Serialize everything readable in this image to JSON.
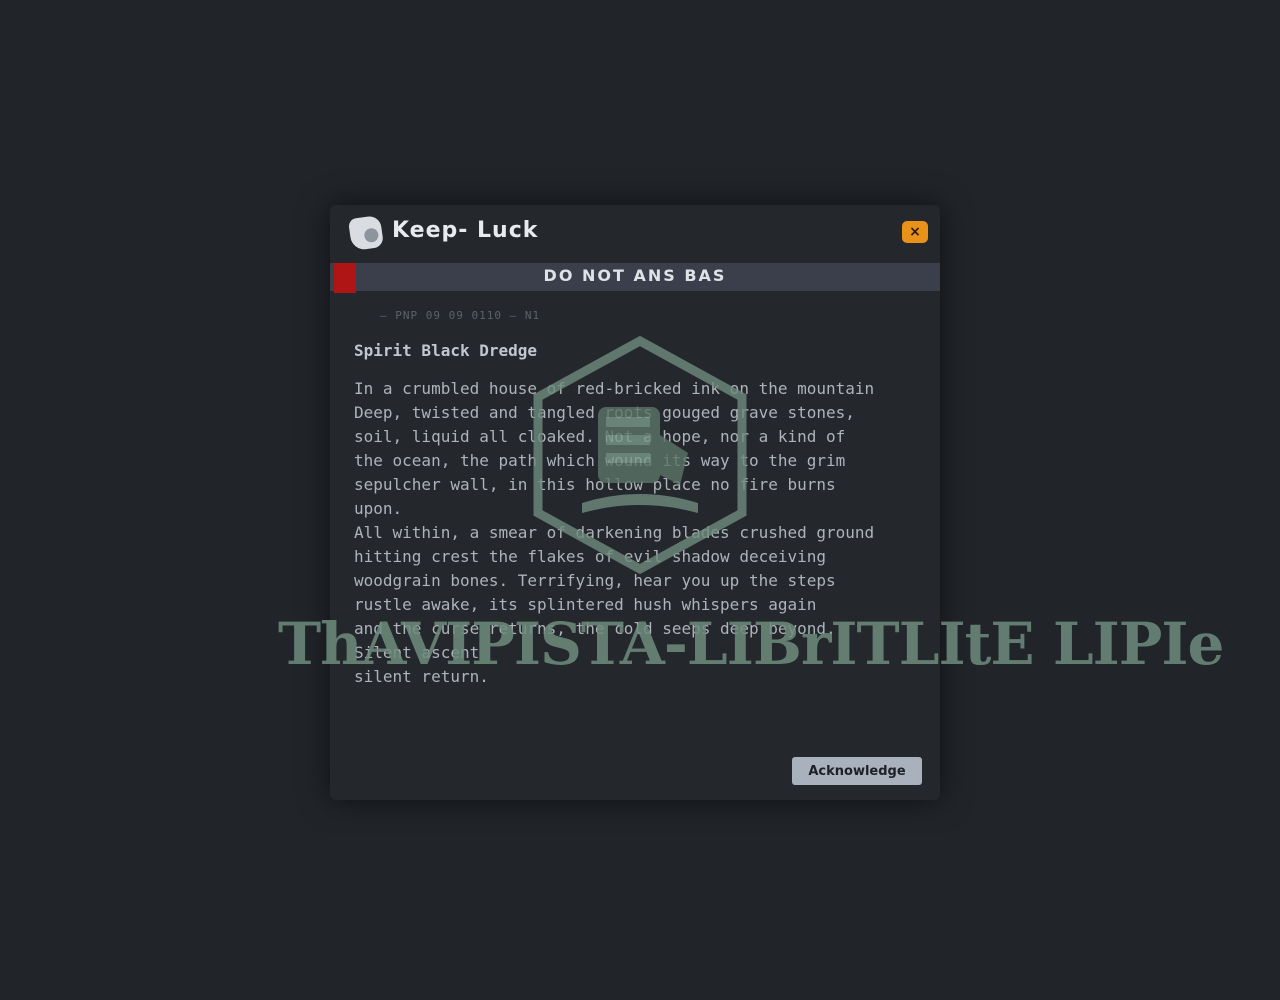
{
  "window": {
    "title": "Keep- Luck",
    "close_label": "×",
    "app_icon": "document-icon"
  },
  "banner": {
    "text": "DO NOT ANS BAS"
  },
  "meta": {
    "text": "— PNP 09 09 0110  —  N1"
  },
  "content": {
    "heading": "Spirit Black Dredge",
    "body": "In a crumbled house of red-bricked ink on the mountain\nDeep, twisted and tangled roots gouged grave stones,\nsoil, liquid all cloaked. Not a hope, nor a kind of \nthe ocean, the path which wound its way to the grim\nsepulcher wall, in this hollow place no fire burns\nupon.\nAll within, a smear of darkening blades crushed ground\nhitting crest the flakes of evil shadow deceiving\nwoodgrain bones. Terrifying, hear you up the steps\nrustle awake, its splintered hush whispers again\nand the curse returns, the cold seeps deep beyond.\nSilent ascent\nsilent return."
  },
  "watermark": {
    "text": "ThAVIPISTA-LIBrITLItE LIPIe"
  },
  "actions": {
    "ok_label": "Acknowledge"
  }
}
